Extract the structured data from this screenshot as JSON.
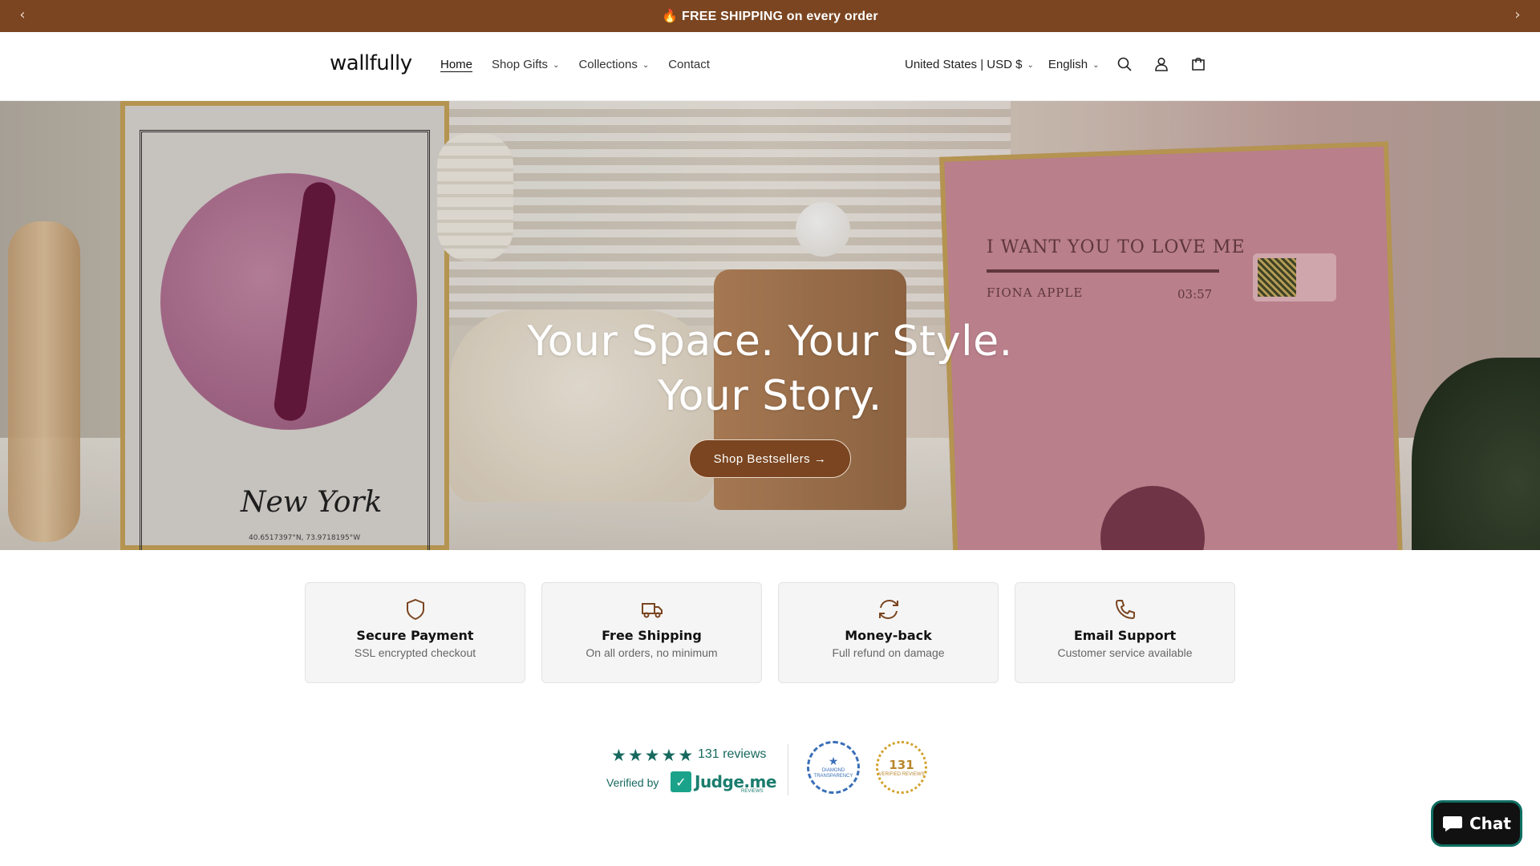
{
  "announcement": {
    "text": "🔥 FREE SHIPPING on every order",
    "prev_icon": "chevron-left-icon",
    "next_icon": "chevron-right-icon"
  },
  "header": {
    "logo": "wallfully",
    "nav": [
      {
        "label": "Home",
        "active": true,
        "has_dropdown": false
      },
      {
        "label": "Shop Gifts",
        "active": false,
        "has_dropdown": true
      },
      {
        "label": "Collections",
        "active": false,
        "has_dropdown": true
      },
      {
        "label": "Contact",
        "active": false,
        "has_dropdown": false
      }
    ],
    "currency": "United States | USD $",
    "language": "English",
    "icons": [
      "search-icon",
      "account-icon",
      "cart-icon"
    ]
  },
  "hero": {
    "title_line1": "Your Space. Your Style.",
    "title_line2": "Your Story.",
    "cta": "Shop Bestsellers →",
    "poster_left_city": "New York",
    "poster_left_coords": "40.6517397°N, 73.9718195°W",
    "poster_right_song": "I WANT YOU TO LOVE ME",
    "poster_right_artist": "FIONA APPLE",
    "poster_right_time": "03:57"
  },
  "features": [
    {
      "icon": "shield-icon",
      "title": "Secure Payment",
      "subtitle": "SSL encrypted checkout"
    },
    {
      "icon": "truck-icon",
      "title": "Free Shipping",
      "subtitle": "On all orders, no minimum"
    },
    {
      "icon": "refresh-icon",
      "title": "Money-back",
      "subtitle": "Full refund on damage"
    },
    {
      "icon": "phone-icon",
      "title": "Email Support",
      "subtitle": "Customer service available"
    }
  ],
  "reviews": {
    "rating_stars": 5,
    "count_text": "131 reviews",
    "verified_by": "Verified by",
    "provider": "Judge.me",
    "provider_sub": "REVIEWS",
    "badge_diamond": "DIAMOND TRANSPARENCY",
    "badge_gold_number": "131",
    "badge_gold_text": "VERIFIED REVIEWS"
  },
  "chat": {
    "label": "Chat"
  },
  "colors": {
    "brand_brown": "#7a4520",
    "review_green": "#17695f"
  }
}
